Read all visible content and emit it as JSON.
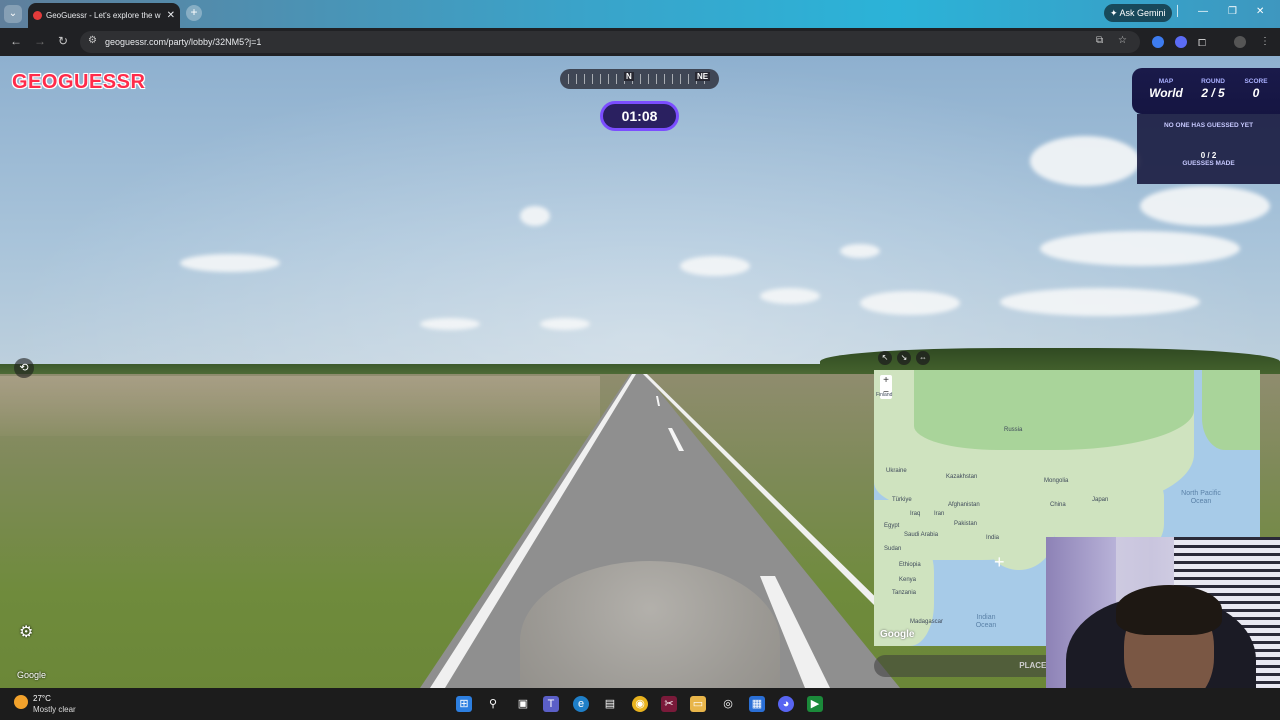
{
  "browser": {
    "tab_title": "GeoGuessr - Let's explore the w",
    "tab_close": "✕",
    "new_tab": "+",
    "gemini_label": "Ask Gemini",
    "url": "geoguessr.com/party/lobby/32NM5?j=1"
  },
  "game": {
    "logo": "GEOGUESSR",
    "compass": {
      "north": "N",
      "northeast": "NE"
    },
    "timer": "01:08",
    "status": {
      "map_label": "MAP",
      "map_value": "World",
      "round_label": "ROUND",
      "round_value": "2 / 5",
      "score_label": "SCORE",
      "score_value": "0"
    },
    "guess_note": "NO ONE HAS GUESSED YET",
    "guess_count": "0 / 2",
    "guess_label": "GUESSES MADE",
    "place_button": "PLACE YO",
    "watermark": "Google"
  },
  "map": {
    "zoom_in": "+",
    "zoom_out": "−",
    "google": "Google",
    "labels": [
      {
        "text": "Russia"
      },
      {
        "text": "Kazakhstan"
      },
      {
        "text": "Mongolia"
      },
      {
        "text": "China"
      },
      {
        "text": "Ukraine"
      },
      {
        "text": "Türkiye"
      },
      {
        "text": "Iraq"
      },
      {
        "text": "Iran"
      },
      {
        "text": "Afghanistan"
      },
      {
        "text": "Pakistan"
      },
      {
        "text": "Saudi Arabia"
      },
      {
        "text": "India"
      },
      {
        "text": "Egypt"
      },
      {
        "text": "Sudan"
      },
      {
        "text": "Ethiopia"
      },
      {
        "text": "Kenya"
      },
      {
        "text": "Tanzania"
      },
      {
        "text": "Madagascar"
      },
      {
        "text": "Japan"
      },
      {
        "text": "Finland"
      }
    ],
    "north_pacific": "North Pacific Ocean",
    "indian_ocean": "Indian Ocean"
  },
  "taskbar": {
    "temp": "27°C",
    "weather": "Mostly clear"
  },
  "colors": {
    "brand": "#ff2b4a",
    "timer_border": "#7b4dff",
    "status_bg": "#1a1a4a"
  }
}
